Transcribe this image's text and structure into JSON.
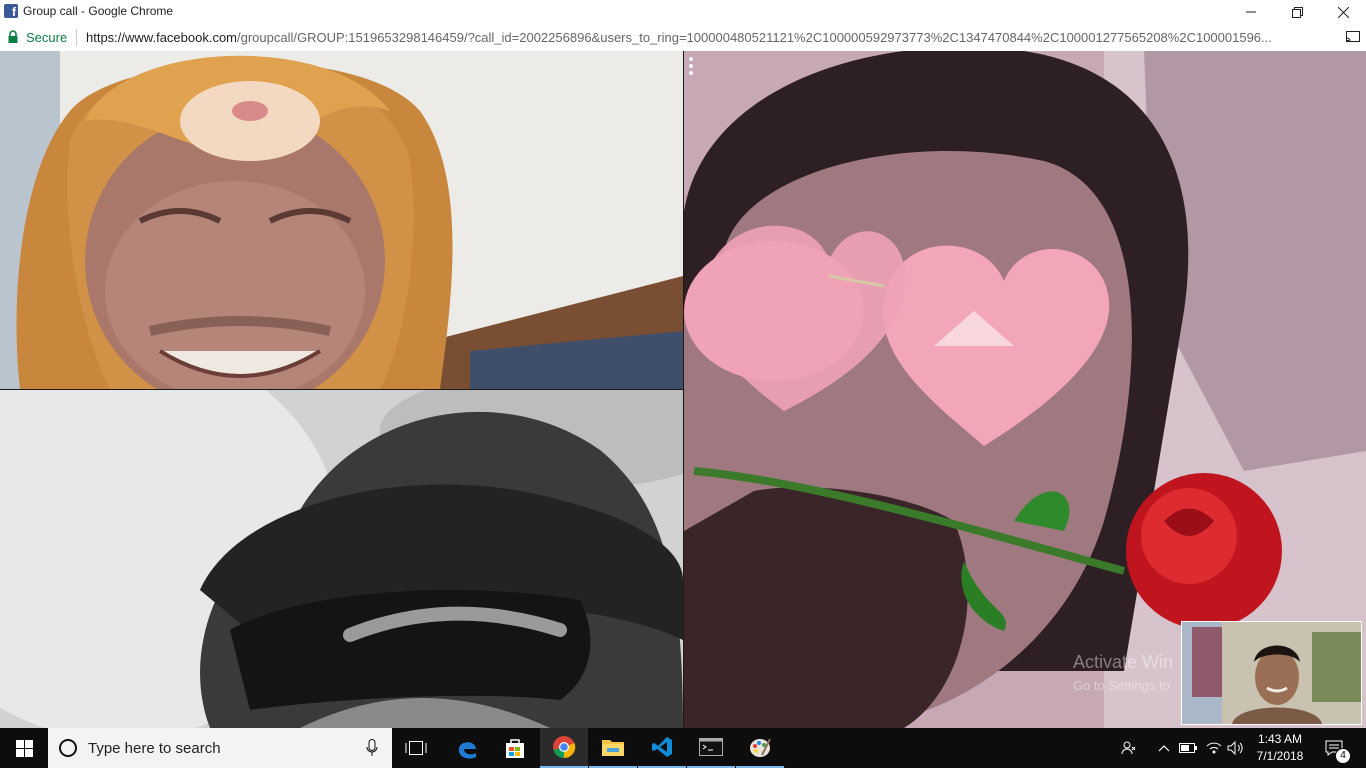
{
  "window": {
    "title": "Group call - Google Chrome"
  },
  "addressbar": {
    "secure_label": "Secure",
    "url_host": "https://www.facebook.com",
    "url_path": "/groupcall/GROUP:1519653298146459/?call_id=2002256896&users_to_ring=100000480521121%2C100000592973773%2C1347470844%2C100001277565208%2C100001596..."
  },
  "call": {
    "participants": [
      {
        "position": "top-left",
        "filter": "cat-ears-hood"
      },
      {
        "position": "bottom-left",
        "filter": "sunglasses"
      },
      {
        "position": "right",
        "filter": "heart-glasses-rose"
      }
    ],
    "self_view": {
      "visible": true
    }
  },
  "watermark": {
    "line1": "Activate Win",
    "line2": "Go to Settings to"
  },
  "taskbar": {
    "search_placeholder": "Type here to search",
    "pinned": [
      "task-view-icon",
      "edge-icon",
      "store-icon",
      "chrome-icon",
      "file-explorer-icon",
      "vscode-icon",
      "cmd-icon",
      "paint-icon"
    ],
    "active_app": "chrome-icon",
    "clock_time": "1:43 AM",
    "clock_date": "7/1/2018",
    "notification_count": "4"
  },
  "colors": {
    "facebook_blue": "#3b5998",
    "secure_green": "#0b8043",
    "taskbar_bg": "#0d0d0d",
    "taskbar_accent": "#76b9ed"
  }
}
